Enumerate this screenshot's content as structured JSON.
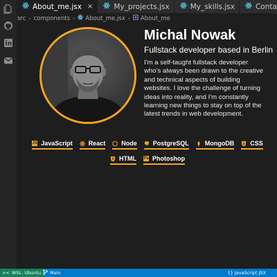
{
  "tabs": [
    {
      "label": "About_me.jsx",
      "active": true,
      "close": "×"
    },
    {
      "label": "My_projects.jsx",
      "active": false
    },
    {
      "label": "My_skills.jsx",
      "active": false
    },
    {
      "label": "Contact_me.jsx",
      "active": false
    }
  ],
  "breadcrumb": [
    "src",
    "components",
    "About_me.jsx",
    "About_me"
  ],
  "profile": {
    "name": "Michal Nowak",
    "subtitle": "Fullstack developer based in Berlin",
    "bio": "I'm a self-taught fullstack developer who's always been drawn to the creative and technical aspects of building websites. I love the challenge of turning ideas into reality, and I'm constantly learning new things to stay on top of the latest trends in web development."
  },
  "skills": [
    {
      "label": "JavaScript",
      "icon": "javascript-icon"
    },
    {
      "label": "React",
      "icon": "react-icon"
    },
    {
      "label": "Node",
      "icon": "node-icon"
    },
    {
      "label": "PostgreSQL",
      "icon": "postgresql-icon"
    },
    {
      "label": "MongoDB",
      "icon": "mongodb-icon"
    },
    {
      "label": "CSS",
      "icon": "css-icon"
    },
    {
      "label": "HTML",
      "icon": "html-icon"
    },
    {
      "label": "Photoshop",
      "icon": "photoshop-icon"
    }
  ],
  "statusbar": {
    "remote": "WSL: Ubuntu",
    "branch": "Main",
    "language": "{} JavaScript JSX"
  },
  "colors": {
    "accent": "#f5a623",
    "editor_bg": "#1e1e1e",
    "statusbar_bg": "#007acc",
    "remote_bg": "#16825d",
    "react_icon": "#61dafb"
  }
}
